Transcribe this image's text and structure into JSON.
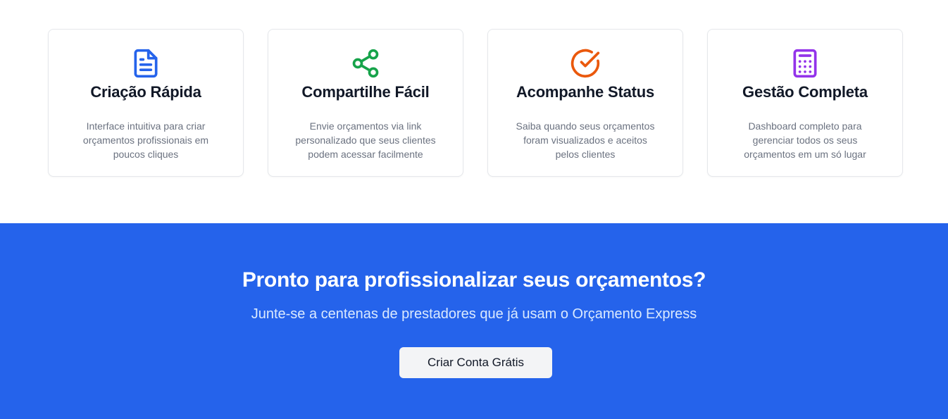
{
  "features": [
    {
      "icon": "document-icon",
      "color": "#2563eb",
      "title": "Criação Rápida",
      "description": "Interface intuitiva para criar orçamentos profissionais em poucos cliques"
    },
    {
      "icon": "share-icon",
      "color": "#16a34a",
      "title": "Compartilhe Fácil",
      "description": "Envie orçamentos via link personalizado que seus clientes podem acessar facilmente"
    },
    {
      "icon": "check-circle-icon",
      "color": "#ea580c",
      "title": "Acompanhe Status",
      "description": "Saiba quando seus orçamentos foram visualizados e aceitos pelos clientes"
    },
    {
      "icon": "calculator-icon",
      "color": "#9333ea",
      "title": "Gestão Completa",
      "description": "Dashboard completo para gerenciar todos os seus orçamentos em um só lugar"
    }
  ],
  "cta": {
    "title": "Pronto para profissionalizar seus orçamentos?",
    "subtitle": "Junte-se a centenas de prestadores que já usam o Orçamento Express",
    "button_label": "Criar Conta Grátis",
    "background": "#2563eb"
  }
}
